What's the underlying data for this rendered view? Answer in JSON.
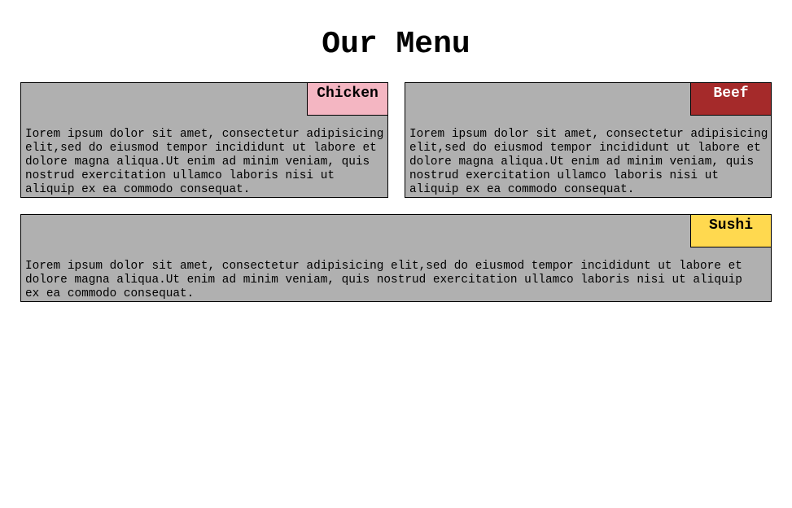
{
  "page": {
    "title": "Our Menu"
  },
  "menu": {
    "items": [
      {
        "tag": "Chicken",
        "tag_color": "#f4b6c2",
        "tag_text_color": "#000000",
        "description": "Iorem ipsum dolor sit amet, consectetur adipisicing elit,sed do eiusmod tempor incididunt ut labore et dolore magna aliqua.Ut enim ad minim veniam, quis nostrud exercitation ullamco laboris nisi ut aliquip ex ea commodo consequat."
      },
      {
        "tag": "Beef",
        "tag_color": "#a52a2a",
        "tag_text_color": "#ffffff",
        "description": "Iorem ipsum dolor sit amet, consectetur adipisicing elit,sed do eiusmod tempor incididunt ut labore et dolore magna aliqua.Ut enim ad minim veniam, quis nostrud exercitation ullamco laboris nisi ut aliquip ex ea commodo consequat."
      },
      {
        "tag": "Sushi",
        "tag_color": "#ffd94f",
        "tag_text_color": "#000000",
        "description": "Iorem ipsum dolor sit amet, consectetur adipisicing elit,sed do eiusmod tempor incididunt ut labore et dolore magna aliqua.Ut enim ad minim veniam, quis nostrud exercitation ullamco laboris nisi ut aliquip ex ea commodo consequat."
      }
    ]
  },
  "colors": {
    "card_background": "#b0b0b0",
    "border": "#000000"
  }
}
